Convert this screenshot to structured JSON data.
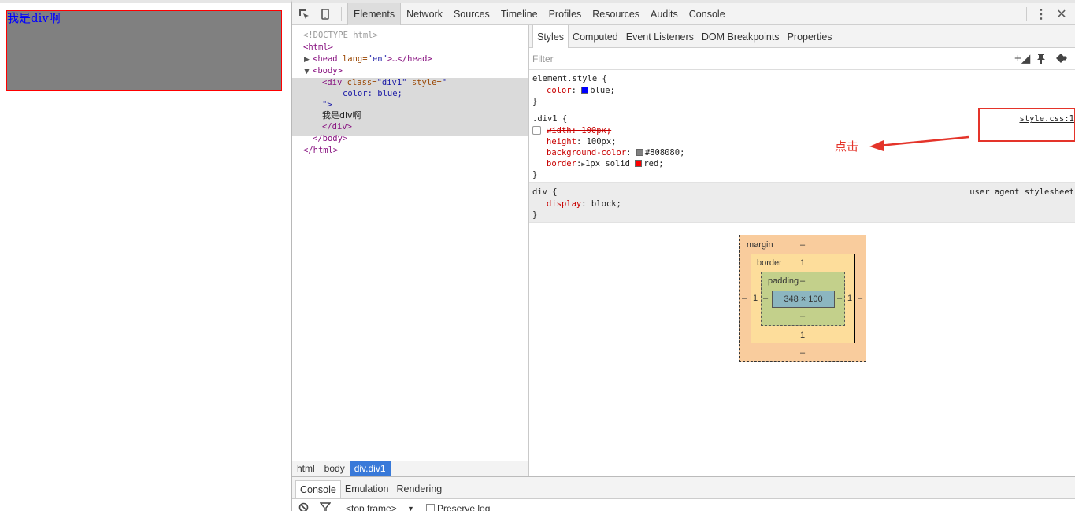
{
  "preview": {
    "div_text": "我是div啊"
  },
  "toolbar": {
    "tabs": [
      "Elements",
      "Network",
      "Sources",
      "Timeline",
      "Profiles",
      "Resources",
      "Audits",
      "Console"
    ],
    "inspect_icon": "inspect-icon",
    "device_icon": "device-mode-icon"
  },
  "dom": {
    "doctype": "<!DOCTYPE html>",
    "html_open": "<html>",
    "head_tag": "<head",
    "head_attr": " lang=",
    "head_val": "\"en\"",
    "head_close": ">…</head>",
    "body_open": "<body>",
    "div_open": "<div",
    "div_class_attr": " class=",
    "div_class_val": "\"div1\"",
    "div_style_attr": " style=",
    "div_style_val": "\"",
    "style_value": "color: blue;",
    "style_end": "\">",
    "text": "我是div啊",
    "div_close": "</div>",
    "body_close": "</body>",
    "html_close": "</html>"
  },
  "breadcrumb": [
    "html",
    "body",
    "div.div1"
  ],
  "styles": {
    "subtabs": [
      "Styles",
      "Computed",
      "Event Listeners",
      "DOM Breakpoints",
      "Properties"
    ],
    "filter_placeholder": "Filter",
    "element_style": {
      "selector": "element.style {",
      "prop": "color",
      "value": "blue;",
      "swatch": "#0000ff"
    },
    "div1_rule": {
      "selector": ".div1 {",
      "source": "style.css:1",
      "width": "width: 100px;",
      "height_name": "height",
      "height_val": "100px;",
      "bg_name": "background-color",
      "bg_val": "#808080;",
      "bg_swatch": "#808080",
      "border_name": "border",
      "border_val": "1px solid",
      "border_color": "red;",
      "border_swatch": "#ff0000"
    },
    "ua_rule": {
      "selector": "div {",
      "source": "user agent stylesheet",
      "prop": "display",
      "value": "block;"
    },
    "close_brace": "}"
  },
  "annotation": {
    "text": "点击",
    "color": "#e4342a"
  },
  "box_model": {
    "margin_label": "margin",
    "margin_top": "–",
    "margin_bottom": "–",
    "margin_left": "–",
    "margin_right": "–",
    "border_label": "border",
    "border_top": "1",
    "border_bottom": "1",
    "border_left": "1",
    "border_right": "1",
    "padding_label": "padding",
    "padding_top": "–",
    "padding_bottom": "–",
    "padding_left": "–",
    "padding_right": "–",
    "content": "348 × 100"
  },
  "drawer": {
    "tabs": [
      "Console",
      "Emulation",
      "Rendering"
    ],
    "frame": "<top frame>",
    "preserve_log": "Preserve log"
  }
}
